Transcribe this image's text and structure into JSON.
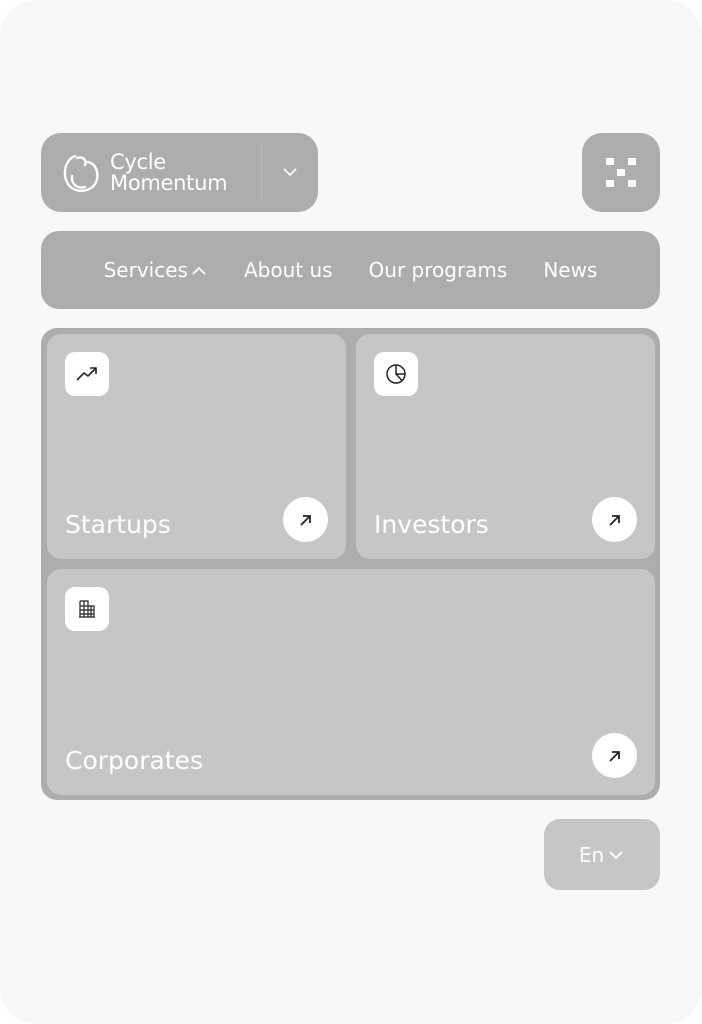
{
  "brand": {
    "line1": "Cycle",
    "line2": "Momentum",
    "logo_icon": "circle-swirl-icon"
  },
  "header": {
    "brand_dropdown_icon": "chevron-down-icon",
    "menu_icon": "grid-dots-icon"
  },
  "nav": {
    "items": [
      {
        "label": "Services",
        "icon": "chevron-up-icon",
        "expanded": true
      },
      {
        "label": "About us"
      },
      {
        "label": "Our programs"
      },
      {
        "label": "News"
      }
    ]
  },
  "services": {
    "cards": [
      {
        "label": "Startups",
        "icon": "trending-up-icon",
        "action_icon": "arrow-up-right-icon"
      },
      {
        "label": "Investors",
        "icon": "pie-chart-icon",
        "action_icon": "arrow-up-right-icon"
      },
      {
        "label": "Corporates",
        "icon": "building-icon",
        "action_icon": "arrow-up-right-icon"
      }
    ]
  },
  "language": {
    "selected": "En",
    "icon": "chevron-down-icon"
  },
  "colors": {
    "background": "#f8f8f8",
    "surface": "#adadad",
    "card": "#c6c6c6",
    "text": "#ffffff"
  }
}
